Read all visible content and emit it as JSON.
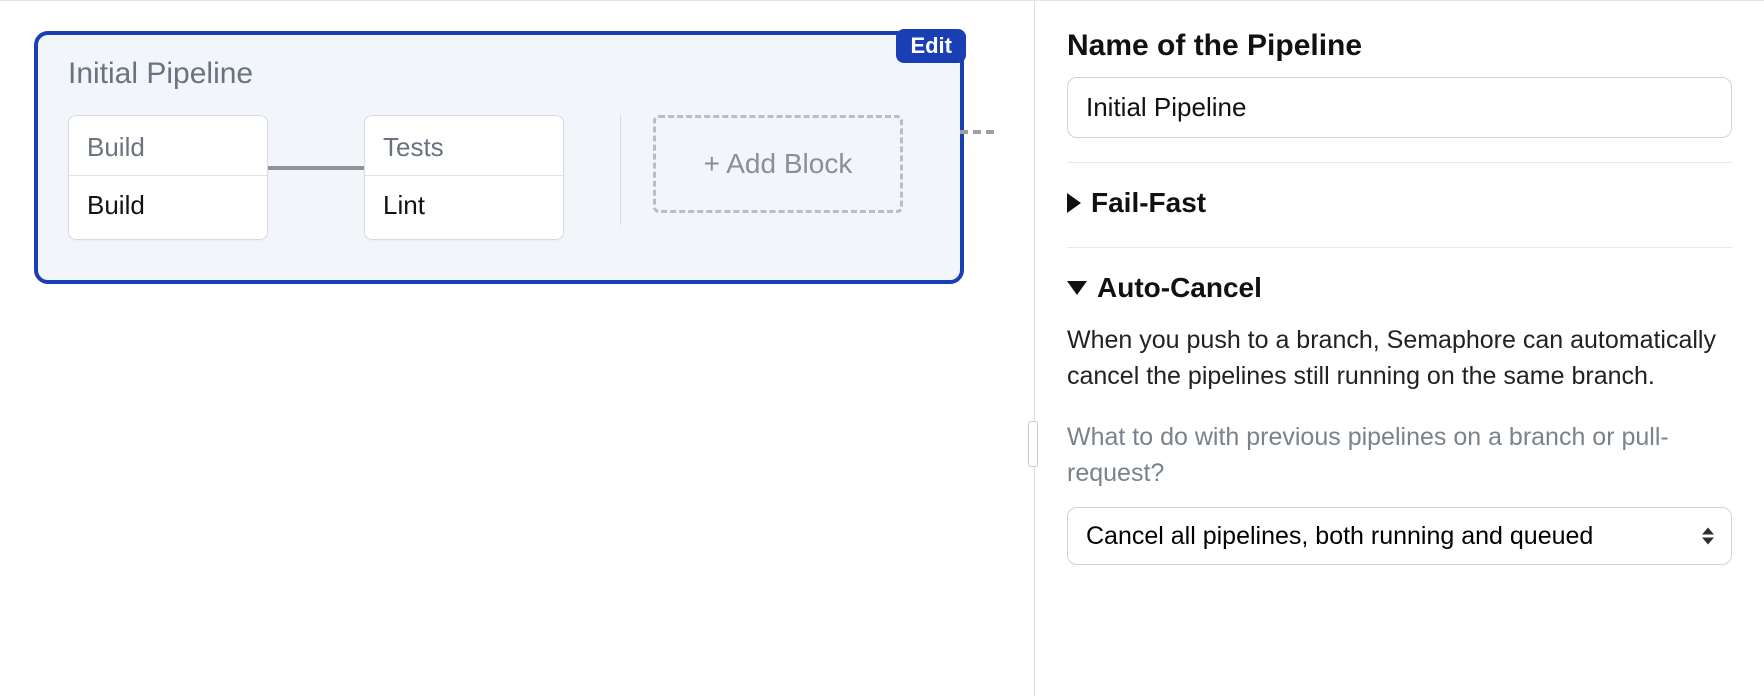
{
  "pipeline": {
    "title": "Initial Pipeline",
    "edit_label": "Edit",
    "blocks": [
      {
        "name": "Build",
        "job": "Build"
      },
      {
        "name": "Tests",
        "job": "Lint"
      }
    ],
    "add_block_label": "+ Add Block"
  },
  "sidebar": {
    "name_label": "Name of the Pipeline",
    "name_value": "Initial Pipeline",
    "fail_fast": {
      "title": "Fail-Fast",
      "expanded": false
    },
    "auto_cancel": {
      "title": "Auto-Cancel",
      "expanded": true,
      "description": "When you push to a branch, Semaphore can automatically cancel the pipelines still running on the same branch.",
      "prompt": "What to do with previous pipelines on a branch or pull-request?",
      "select_value": "Cancel all pipelines, both running and queued",
      "options": [
        "Cancel all pipelines, both running and queued"
      ]
    }
  }
}
